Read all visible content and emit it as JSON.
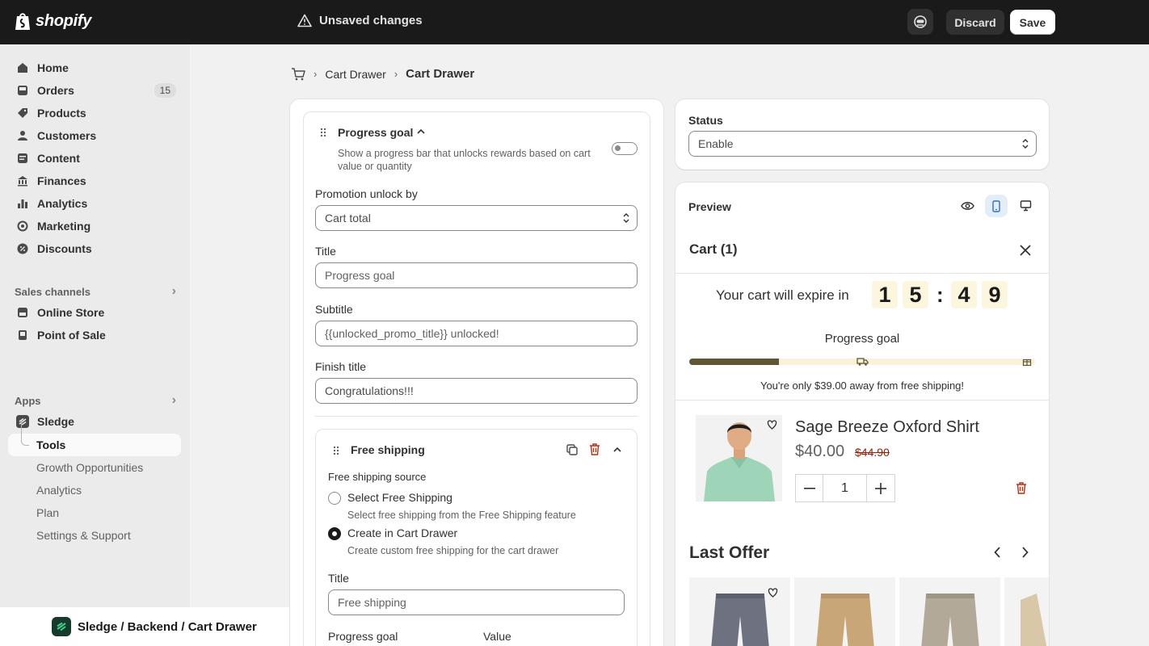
{
  "topbar": {
    "brand": "shopify",
    "unsaved_text": "Unsaved changes",
    "discard_label": "Discard",
    "save_label": "Save"
  },
  "sidebar": {
    "items": [
      {
        "label": "Home",
        "icon": "home-icon"
      },
      {
        "label": "Orders",
        "icon": "orders-icon",
        "badge": "15"
      },
      {
        "label": "Products",
        "icon": "tag-icon"
      },
      {
        "label": "Customers",
        "icon": "person-icon"
      },
      {
        "label": "Content",
        "icon": "content-icon"
      },
      {
        "label": "Finances",
        "icon": "bank-icon"
      },
      {
        "label": "Analytics",
        "icon": "bar-chart-icon"
      },
      {
        "label": "Marketing",
        "icon": "target-icon"
      },
      {
        "label": "Discounts",
        "icon": "discount-icon"
      }
    ],
    "sales_channels_label": "Sales channels",
    "channels": [
      {
        "label": "Online Store"
      },
      {
        "label": "Point of Sale"
      }
    ],
    "apps_label": "Apps",
    "app_name": "Sledge",
    "app_sub": [
      "Tools",
      "Growth Opportunities",
      "Analytics",
      "Plan",
      "Settings & Support"
    ]
  },
  "bottom_label": "Sledge / Backend / Cart Drawer",
  "breadcrumb": {
    "parent": "Cart Drawer",
    "current": "Cart Drawer"
  },
  "progress_goal": {
    "title": "Progress goal",
    "description": "Show a progress bar that unlocks rewards based on cart value or quantity",
    "promotion_unlock_label": "Promotion unlock by",
    "promotion_unlock_value": "Cart total",
    "title_label": "Title",
    "title_value": "Progress goal",
    "subtitle_label": "Subtitle",
    "subtitle_value": "{{unlocked_promo_title}} unlocked!",
    "finish_title_label": "Finish title",
    "finish_title_value": "Congratulations!!!"
  },
  "free_shipping": {
    "title": "Free shipping",
    "source_label": "Free shipping source",
    "option1_label": "Select Free Shipping",
    "option1_help": "Select free shipping from the Free Shipping feature",
    "option2_label": "Create in Cart Drawer",
    "option2_help": "Create custom free shipping for the cart drawer",
    "title_label": "Title",
    "title_value": "Free shipping",
    "progress_goal_label": "Progress goal",
    "value_label": "Value"
  },
  "status": {
    "label": "Status",
    "value": "Enable"
  },
  "preview": {
    "label": "Preview",
    "cart_title": "Cart (1)",
    "expire_text": "Your cart will expire in",
    "timer": [
      "1",
      "5",
      "4",
      "9"
    ],
    "progress_title": "Progress goal",
    "progress_fraction": 0.26,
    "progress_message": "You're only $39.00 away from free shipping!",
    "product_name": "Sage Breeze Oxford Shirt",
    "price": "$40.00",
    "old_price": "$44.90",
    "quantity": "1",
    "last_offer_title": "Last Offer"
  },
  "colors": {
    "topbar_bg": "#1a1a1a",
    "progress_fill": "#5e5637",
    "progress_track": "#fbf1d6",
    "timer_bg": "#fdf6df",
    "old_price": "#8e1f0b",
    "delete_red": "#c5280c"
  }
}
